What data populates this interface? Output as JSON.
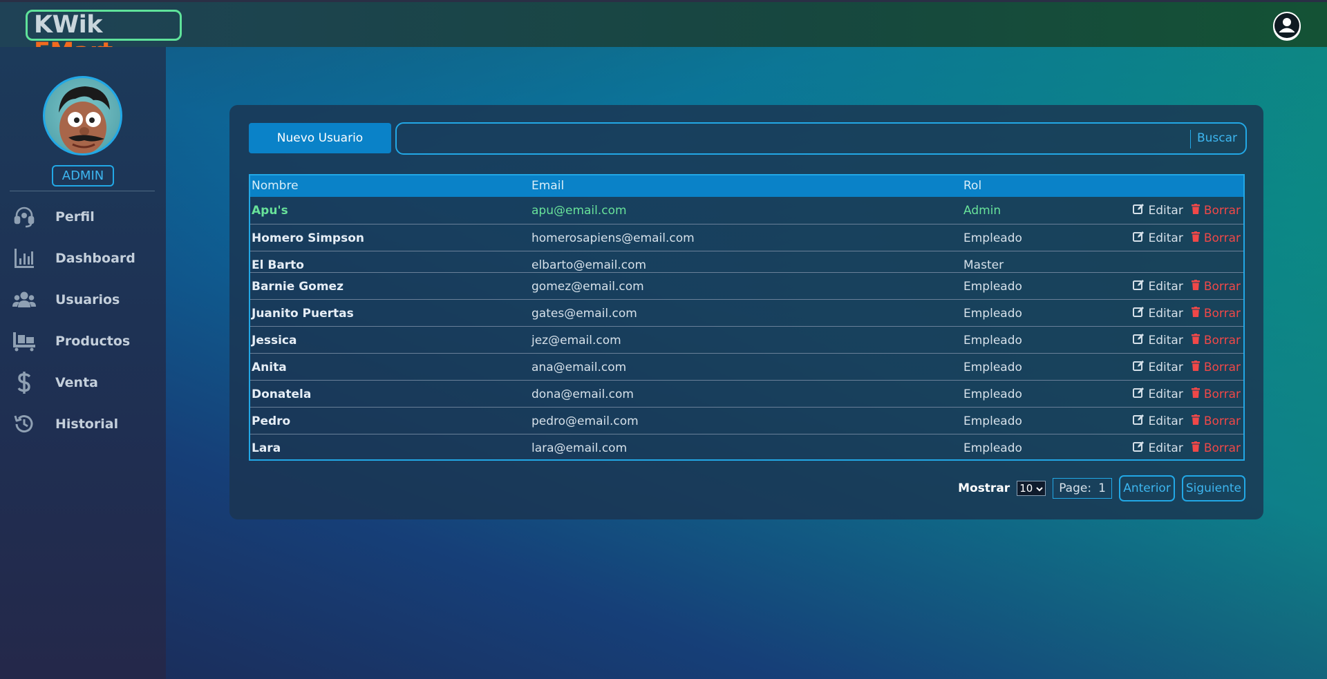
{
  "header": {
    "logo_part1": "KWik",
    "logo_part2": "EMart",
    "user_icon": "user-circle-icon"
  },
  "sidebar": {
    "role_badge": "ADMIN",
    "items": [
      {
        "label": "Perfil",
        "icon": "headset-icon"
      },
      {
        "label": "Dashboard",
        "icon": "bar-chart-icon"
      },
      {
        "label": "Usuarios",
        "icon": "users-icon"
      },
      {
        "label": "Productos",
        "icon": "pallet-icon"
      },
      {
        "label": "Venta",
        "icon": "dollar-icon"
      },
      {
        "label": "Historial",
        "icon": "history-icon"
      }
    ]
  },
  "toolbar": {
    "new_user_label": "Nuevo Usuario",
    "search_placeholder": "",
    "search_button": "Buscar"
  },
  "table": {
    "columns": [
      "Nombre",
      "Email",
      "Rol"
    ],
    "edit_label": "Editar",
    "delete_label": "Borrar",
    "rows": [
      {
        "name": "Apu's",
        "email": "apu@email.com",
        "rol": "Admin",
        "actions": true
      },
      {
        "name": "Homero Simpson",
        "email": "homerosapiens@email.com",
        "rol": "Empleado",
        "actions": true
      },
      {
        "name": "El Barto",
        "email": "elbarto@email.com",
        "rol": "Master",
        "actions": false
      },
      {
        "name": "Barnie Gomez",
        "email": "gomez@email.com",
        "rol": "Empleado",
        "actions": true
      },
      {
        "name": "Juanito Puertas",
        "email": "gates@email.com",
        "rol": "Empleado",
        "actions": true
      },
      {
        "name": "Jessica",
        "email": "jez@email.com",
        "rol": "Empleado",
        "actions": true
      },
      {
        "name": "Anita",
        "email": "ana@email.com",
        "rol": "Empleado",
        "actions": true
      },
      {
        "name": "Donatela",
        "email": "dona@email.com",
        "rol": "Empleado",
        "actions": true
      },
      {
        "name": "Pedro",
        "email": "pedro@email.com",
        "rol": "Empleado",
        "actions": true
      },
      {
        "name": "Lara",
        "email": "lara@email.com",
        "rol": "Empleado",
        "actions": true
      }
    ]
  },
  "pagination": {
    "show_label": "Mostrar",
    "page_size": "10",
    "page_label": "Page:",
    "page_number": "1",
    "prev_label": "Anterior",
    "next_label": "Siguiente"
  },
  "colors": {
    "accent": "#22a8e6",
    "primary_button": "#0a82c8",
    "highlight_row": "#68e29a",
    "delete": "#f04848",
    "logo_orange": "#f26a1e",
    "logo_border": "#5fe29a"
  }
}
